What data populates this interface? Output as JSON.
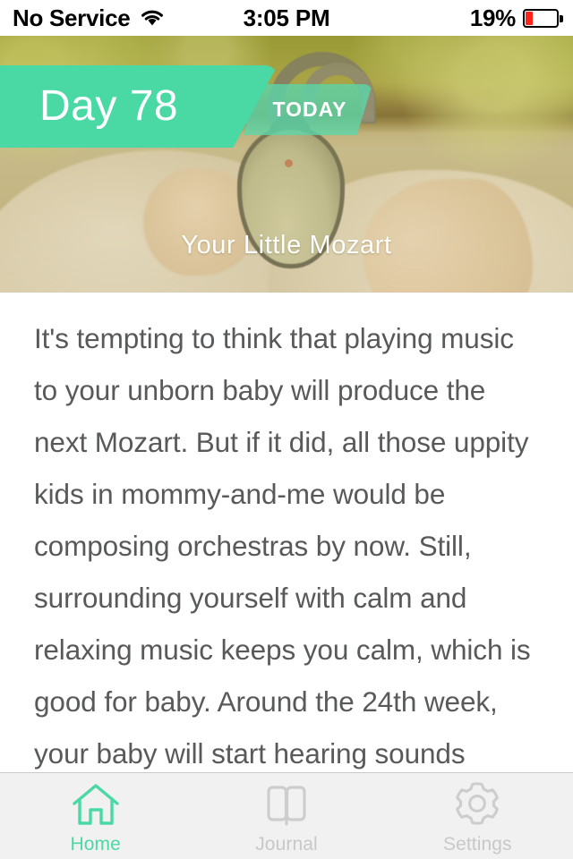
{
  "status_bar": {
    "carrier": "No Service",
    "wifi_icon": "wifi-icon",
    "time": "3:05 PM",
    "battery_percent": "19%",
    "battery_level": 19,
    "battery_color": "#ff2419"
  },
  "hero": {
    "day_label": "Day 78",
    "today_label": "TODAY",
    "title": "Your Little Mozart",
    "banner_color": "#4ad9a5",
    "today_tag_color": "#5dd6a9",
    "image_description": "pregnant-belly-with-headphones"
  },
  "article": {
    "body": "It's tempting to think that playing music to your unborn baby will produce the next Mozart. But if it did, all those uppity kids in mommy-and-me would be composing orchestras by now. Still, surrounding yourself with calm and relaxing music keeps you calm, which is good for baby. Around the 24th week,  your baby will start hearing sounds",
    "text_color": "#58595b"
  },
  "tab_bar": {
    "active_color": "#4ad9a5",
    "inactive_color": "#c8c8c8",
    "tabs": [
      {
        "label": "Home",
        "icon": "home-icon",
        "active": true
      },
      {
        "label": "Journal",
        "icon": "book-icon",
        "active": false
      },
      {
        "label": "Settings",
        "icon": "gear-icon",
        "active": false
      }
    ]
  }
}
